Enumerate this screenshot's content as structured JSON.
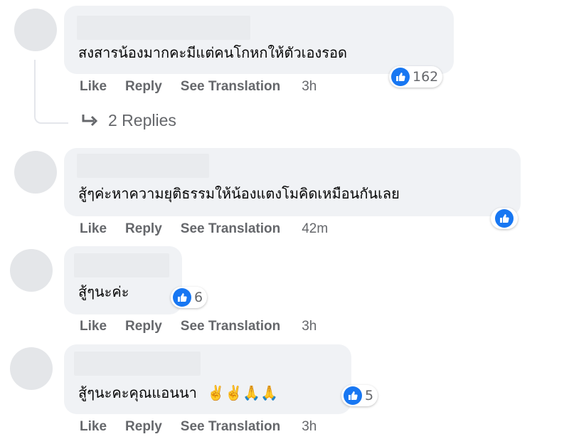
{
  "actions": {
    "like": "Like",
    "reply": "Reply",
    "translate": "See Translation"
  },
  "comments": [
    {
      "text": "สงสารน้องมากคะมีแต่คนโกหกให้ตัวเองรอด",
      "reactions": "162",
      "time": "3h",
      "replies_label": "2 Replies"
    },
    {
      "text": "สู้ๆค่ะหาความยุติธรรมให้น้องแตงโมคิดเหมือนกันเลย",
      "reactions": "",
      "time": "42m"
    },
    {
      "text": "สู้ๆนะค่ะ",
      "reactions": "6",
      "time": "3h"
    },
    {
      "text": "สู้ๆนะคะคุณแอนนา",
      "emojis": "✌️✌️🙏🙏",
      "reactions": "5",
      "time": "3h"
    }
  ],
  "colors": {
    "bubble": "#f0f2f5",
    "accent": "#1877f2",
    "meta": "#65676b"
  },
  "icons": {
    "like": "thumbs-up-icon",
    "reply_arrow": "reply-arrow-icon"
  }
}
